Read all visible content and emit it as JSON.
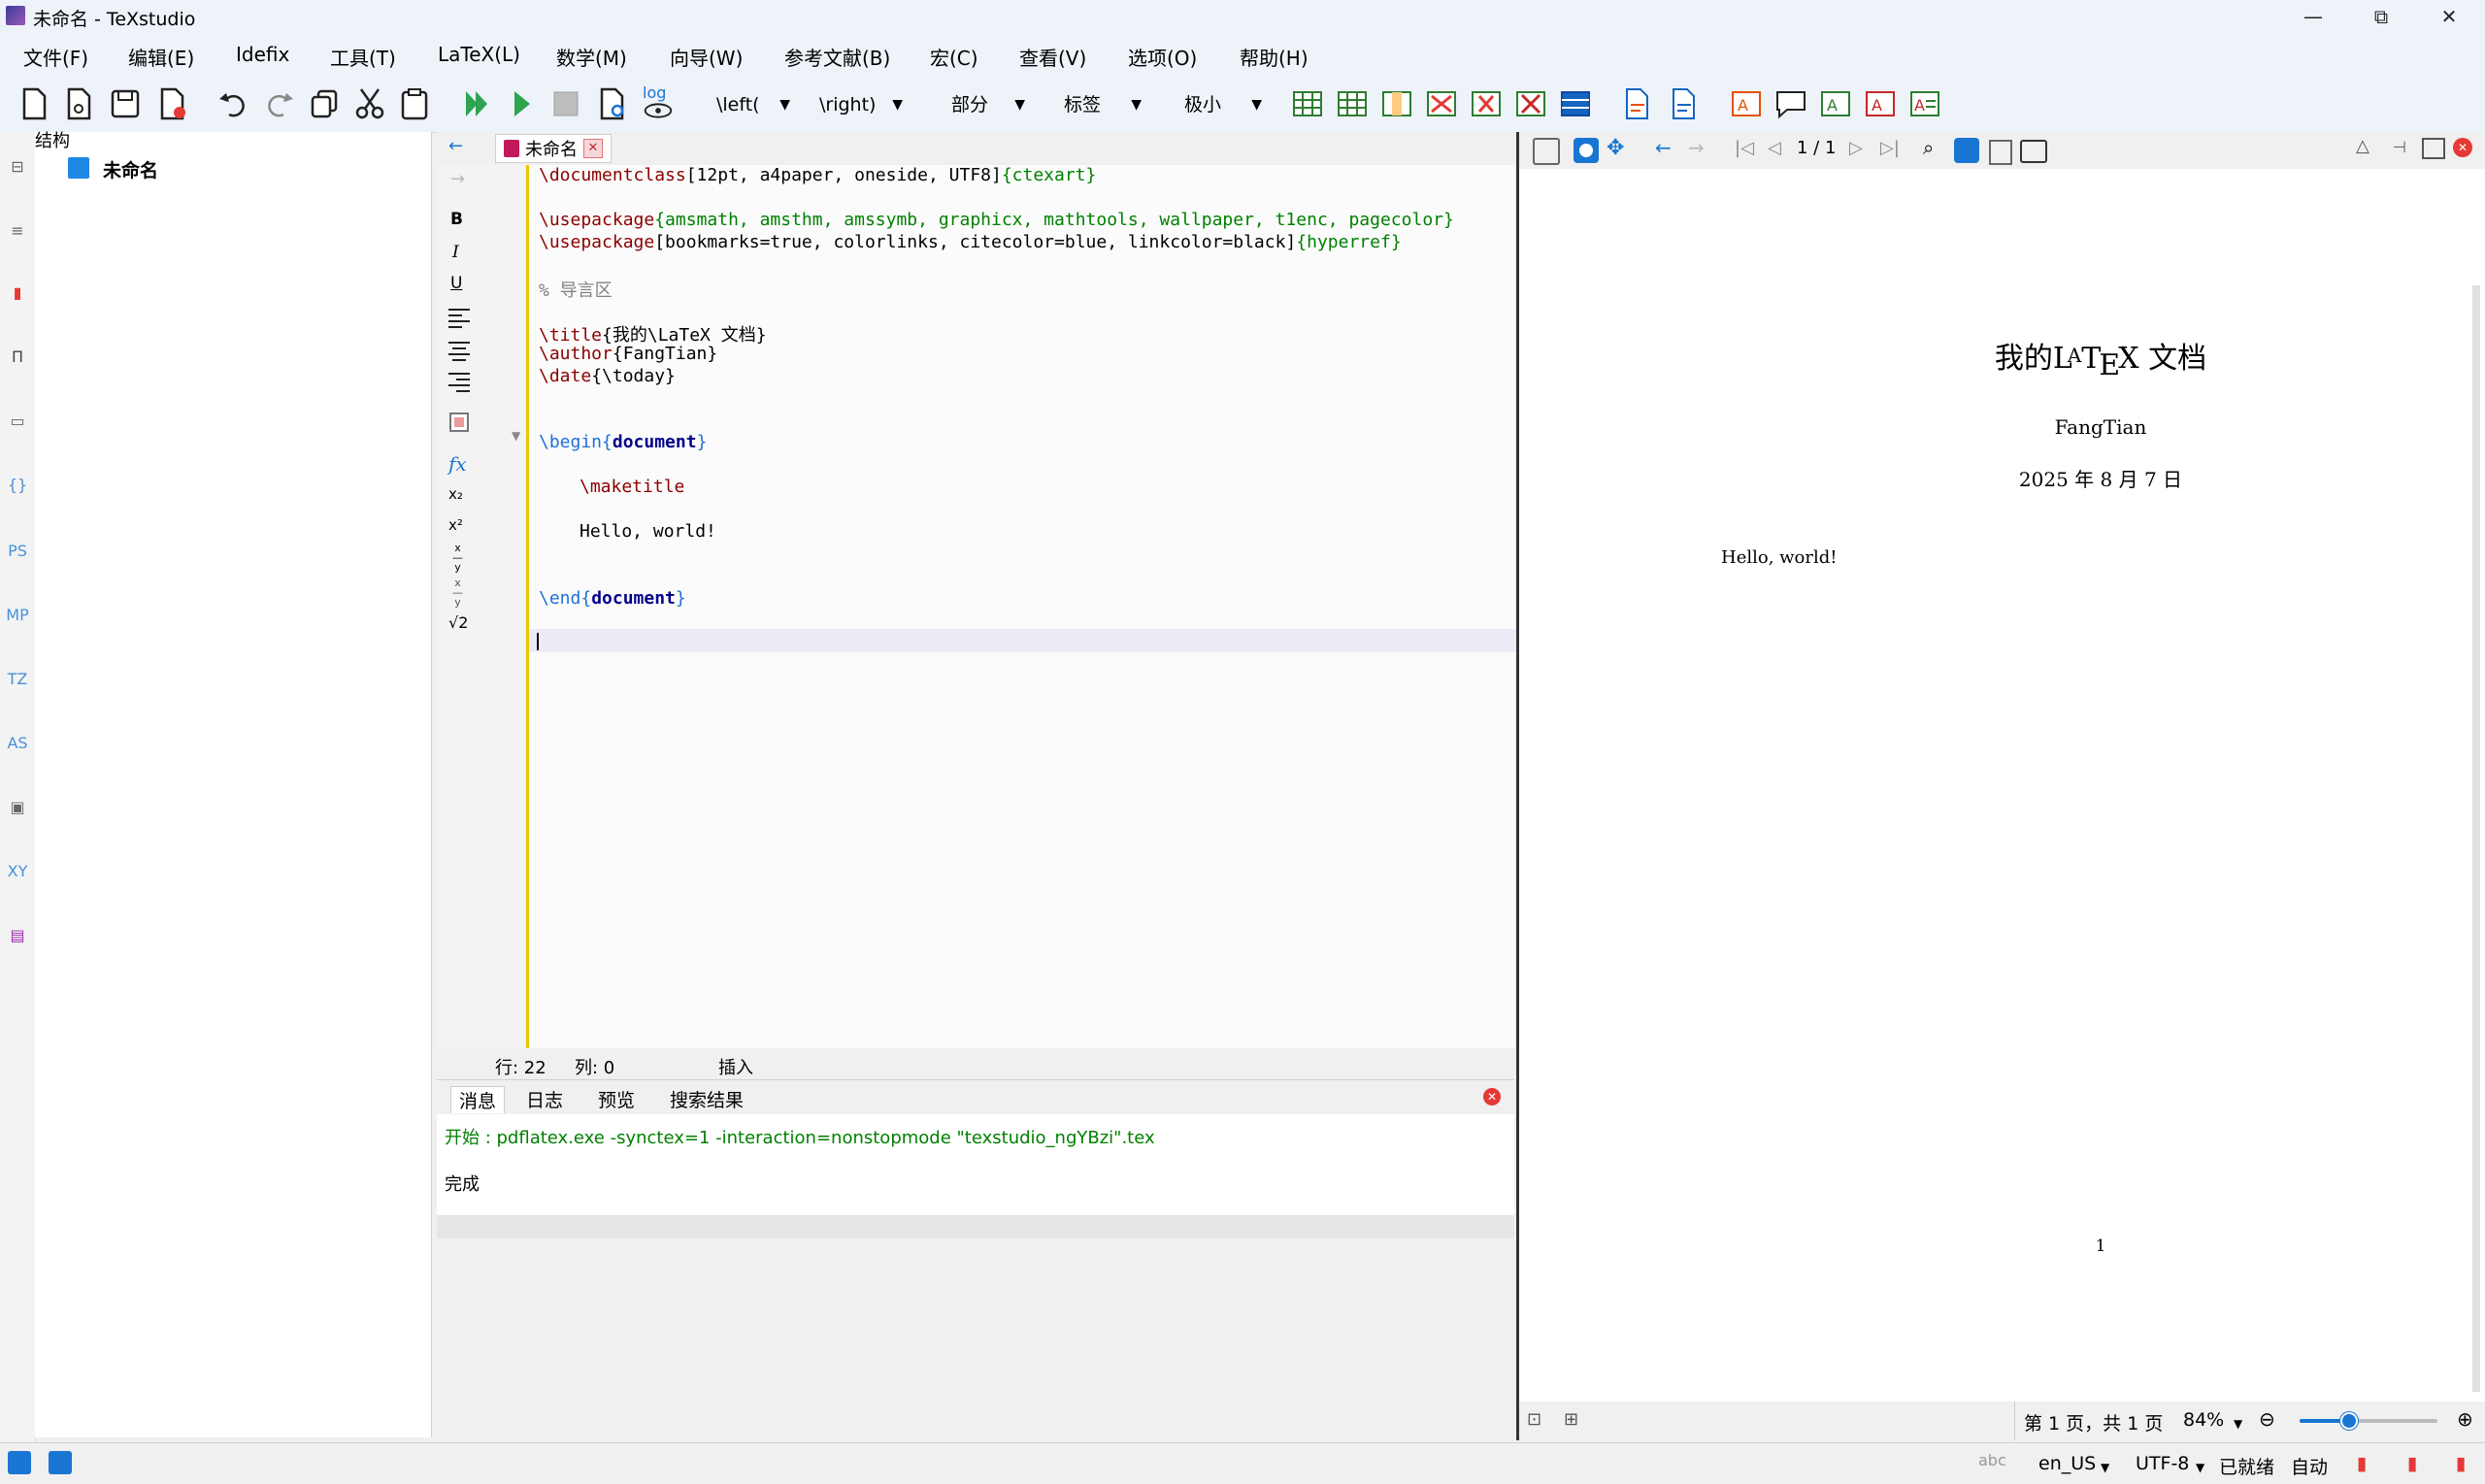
{
  "window": {
    "title": "未命名 - TeXstudio",
    "minimize": "—",
    "maximize": "⧉",
    "close": "✕"
  },
  "menu": [
    "文件(F)",
    "编辑(E)",
    "Idefix",
    "工具(T)",
    "LaTeX(L)",
    "数学(M)",
    "向导(W)",
    "参考文献(B)",
    "宏(C)",
    "查看(V)",
    "选项(O)",
    "帮助(H)"
  ],
  "toolbar": {
    "left_combo": "\\left(",
    "right_combo": "\\right)",
    "section_combo": "部分",
    "label_combo": "标签",
    "size_combo": "极小",
    "log_label": "log"
  },
  "structure": {
    "title": "结构",
    "root": "未命名"
  },
  "leftbar": [
    "PS",
    "MP",
    "TZ",
    "AS",
    "XY"
  ],
  "editor": {
    "tab": "未命名",
    "side_tools": [
      "B",
      "I",
      "U",
      "fx",
      "x₂",
      "x²",
      "√2"
    ],
    "lines": {
      "l1_cmd": "\\documentclass",
      "l1_opt": "[12pt, a4paper, oneside, UTF8]",
      "l1_arg": "{ctexart}",
      "l3_cmd": "\\usepackage",
      "l3_arg": "{amsmath, amsthm, amssymb, graphicx, mathtools, wallpaper, t1enc, pagecolor}",
      "l4_cmd": "\\usepackage",
      "l4_opt": "[bookmarks=true, colorlinks, citecolor=blue, linkcolor=black]",
      "l4_arg": "{hyperref}",
      "l6": "% 导言区",
      "l8_cmd": "\\title",
      "l8_rest": "{我的\\LaTeX 文档}",
      "l9_cmd": "\\author",
      "l9_rest": "{FangTian}",
      "l10_cmd": "\\date",
      "l10_rest": "{\\today}",
      "l13_cmd": "\\begin",
      "l13_env": "document",
      "l15": "\\maketitle",
      "l17": "Hello, world!",
      "l20_cmd": "\\end",
      "l20_env": "document"
    },
    "status_line": "行: 22",
    "status_col": "列: 0",
    "status_mode": "插入"
  },
  "messages": {
    "tabs": [
      "消息",
      "日志",
      "预览",
      "搜索结果"
    ],
    "line1": "开始 : pdflatex.exe -synctex=1 -interaction=nonstopmode \"texstudio_ngYBzi\".tex",
    "line2": "完成"
  },
  "pdf": {
    "page_indicator": "1 / 1",
    "doc_title_a": "我的",
    "doc_title_b": "L",
    "doc_title_c": "A",
    "doc_title_d": "T",
    "doc_title_e": "E",
    "doc_title_f": "X 文档",
    "author": "FangTian",
    "date": "2025 年 8 月 7 日",
    "body": "Hello, world!",
    "page_number": "1",
    "status_pages": "第 1 页，共 1 页",
    "zoom": "84%",
    "zoom_level": 0.35
  },
  "statusbar": {
    "lang": "en_US",
    "encoding": "UTF-8",
    "ready": "已就绪",
    "auto": "自动"
  },
  "colors": {
    "accent": "#4a90d9",
    "message_green": "#008000",
    "editor_gutter": "#e8c600"
  }
}
